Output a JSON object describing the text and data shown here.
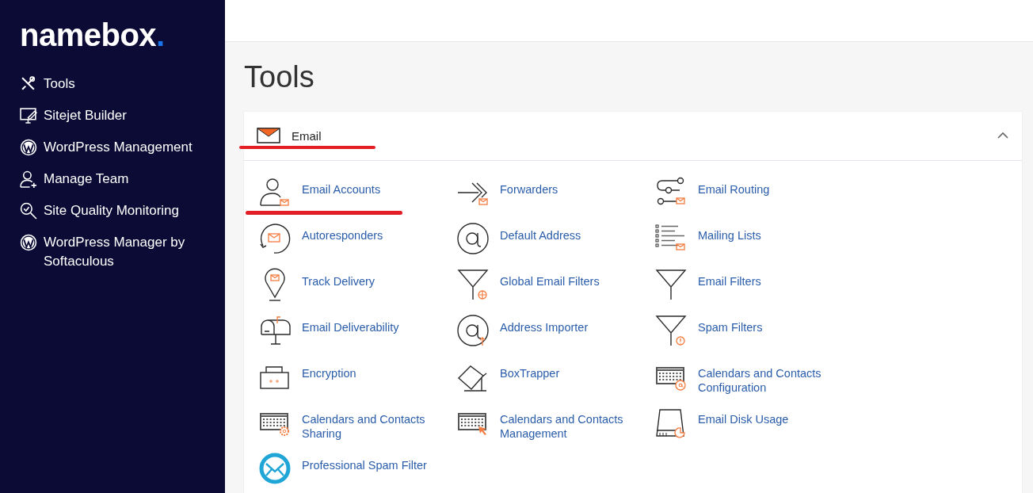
{
  "sidebar": {
    "logo": "namebox",
    "logo_dot": ".",
    "items": [
      {
        "label": "Tools"
      },
      {
        "label": "Sitejet Builder"
      },
      {
        "label": "WordPress Management"
      },
      {
        "label": "Manage Team"
      },
      {
        "label": "Site Quality Monitoring"
      },
      {
        "label": "WordPress Manager by Softaculous"
      }
    ]
  },
  "page_title": "Tools",
  "section": {
    "title": "Email",
    "expanded": true,
    "tools": [
      {
        "label": "Email Accounts"
      },
      {
        "label": "Forwarders"
      },
      {
        "label": "Email Routing"
      },
      {
        "label": "Autoresponders"
      },
      {
        "label": "Default Address"
      },
      {
        "label": "Mailing Lists"
      },
      {
        "label": "Track Delivery"
      },
      {
        "label": "Global Email Filters"
      },
      {
        "label": "Email Filters"
      },
      {
        "label": "Email Deliverability"
      },
      {
        "label": "Address Importer"
      },
      {
        "label": "Spam Filters"
      },
      {
        "label": "Encryption"
      },
      {
        "label": "BoxTrapper"
      },
      {
        "label": "Calendars and Contacts Configuration"
      },
      {
        "label": "Calendars and Contacts Sharing"
      },
      {
        "label": "Calendars and Contacts Management"
      },
      {
        "label": "Email Disk Usage"
      },
      {
        "label": "Professional Spam Filter"
      }
    ]
  }
}
